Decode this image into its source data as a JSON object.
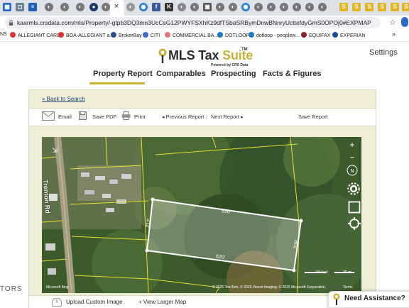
{
  "browser": {
    "url": "kaarmls.crsdata.com/mls/Property/-gtpb3DQ3mn3UcCsG12PWYFSXhKz9dfTSbaSRBymDnwBNnryUcttefdyGmS0OPOj0#EXPMAP",
    "bookmarks": [
      "NS",
      "ALLEGIANT CARD",
      "BOA-ALLEGIANT a...",
      "BrokerBay",
      "CITI",
      "COMMERCIAL BA...",
      "DOTLOOP",
      "dotloop - peoplew...",
      "EQUIFAX",
      "EXPERIAN"
    ],
    "bookmarks_more": "»"
  },
  "site": {
    "logo_main": "MLS Tax ",
    "logo_accent": "Suite",
    "logo_tm": "TM",
    "logo_sub": "Powered by CRS Data",
    "settings": "Settings",
    "nav": [
      "Property Report",
      "Comparables",
      "Prospecting",
      "Facts & Figures"
    ]
  },
  "panel": {
    "back_link": "« Back to Search",
    "toolbar": {
      "email": "Email",
      "save_pdf": "Save PDF",
      "print": "Print",
      "prev": "Previous Report",
      "divider": "|",
      "next": "Next Report",
      "save_report": "Save Report"
    },
    "map": {
      "road": "Trenton Rd",
      "dims": {
        "top": "630'",
        "bottom": "620'",
        "left": "212'",
        "right": "209'"
      },
      "scale_ft": "50 feet",
      "scale_m": "25 m",
      "attribution": "© 2025 TomTom, © 2025 Vexcel Imaging, © 2025 Microsoft Corporation, ",
      "terms": "Terms",
      "brand": "Microsoft Bing"
    },
    "bottom": {
      "upload": "Upload Custom Image",
      "larger": "+ View Larger Map"
    }
  },
  "assist": {
    "label": "Need Assistance?"
  },
  "fragment": "TORS",
  "colors": {
    "accent": "#c9b23a",
    "link": "#23467a",
    "panel_bg": "#efefd8"
  }
}
